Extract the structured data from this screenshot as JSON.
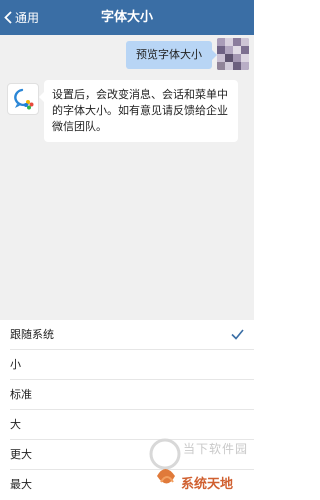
{
  "navbar": {
    "back_label": "通用",
    "title": "字体大小"
  },
  "chat": {
    "preview_message": "预览字体大小",
    "info_message": "设置后，会改变消息、会话和菜单中的字体大小。如有意见请反馈给企业微信团队。"
  },
  "font_options": [
    {
      "label": "跟随系统",
      "selected": true
    },
    {
      "label": "小",
      "selected": false
    },
    {
      "label": "标准",
      "selected": false
    },
    {
      "label": "大",
      "selected": false
    },
    {
      "label": "更大",
      "selected": false
    },
    {
      "label": "最大",
      "selected": false
    }
  ],
  "watermark": {
    "line1": "当下软件园",
    "line2": "系统天地"
  },
  "colors": {
    "navbar": "#3a6ea5",
    "accent": "#3a6ea5",
    "preview_bubble": "#b8d5f5"
  }
}
